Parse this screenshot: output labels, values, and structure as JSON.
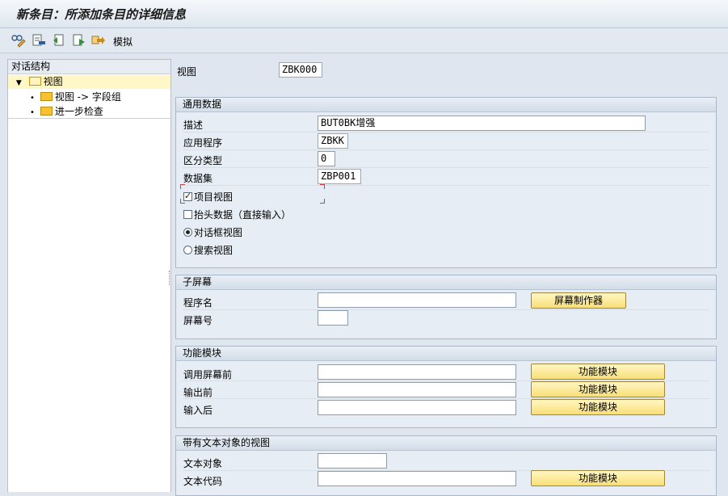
{
  "window": {
    "title": "新条目：所添加条目的详细信息"
  },
  "toolbar": {
    "icons": [
      "display-change-icon",
      "delete-icon",
      "copy-icon",
      "export-icon",
      "navigate-icon"
    ],
    "simulate_label": "模拟"
  },
  "tree": {
    "header": "对话结构",
    "items": [
      {
        "label": "视图",
        "level": 0,
        "expanded": true,
        "selected": true
      },
      {
        "label": "视图 -> 字段组",
        "level": 1,
        "expanded": false,
        "selected": false
      },
      {
        "label": "进一步检查",
        "level": 1,
        "expanded": false,
        "selected": false
      }
    ]
  },
  "view_field": {
    "label": "视图",
    "value": "ZBK000"
  },
  "general": {
    "header": "通用数据",
    "description": {
      "label": "描述",
      "value": "BUT0BK增强"
    },
    "application": {
      "label": "应用程序",
      "value": "ZBKK"
    },
    "diff_type": {
      "label": "区分类型",
      "value": "0"
    },
    "dataset": {
      "label": "数据集",
      "value": "ZBP001"
    },
    "item_view": {
      "label": "项目视图",
      "checked": true
    },
    "header_data": {
      "label": "抬头数据（直接输入）",
      "checked": false
    },
    "dialog_view": {
      "label": "对话框视图",
      "selected": true
    },
    "search_view": {
      "label": "搜索视图",
      "selected": false
    }
  },
  "subscreen": {
    "header": "子屏幕",
    "program": {
      "label": "程序名",
      "value": ""
    },
    "screen_no": {
      "label": "屏幕号",
      "value": ""
    },
    "painter_button": "屏幕制作器"
  },
  "function_modules": {
    "header": "功能模块",
    "before_call": {
      "label": "调用屏幕前",
      "value": ""
    },
    "before_output": {
      "label": "输出前",
      "value": ""
    },
    "after_input": {
      "label": "输入后",
      "value": ""
    },
    "button_label": "功能模块"
  },
  "text_objects": {
    "header": "带有文本对象的视图",
    "text_object": {
      "label": "文本对象",
      "value": ""
    },
    "text_code": {
      "label": "文本代码",
      "value": ""
    },
    "button_label": "功能模块"
  },
  "colors": {
    "background": "#dfe6ef",
    "selection": "#fff8c6",
    "button": "#f9df79",
    "focus": "#d24040"
  }
}
